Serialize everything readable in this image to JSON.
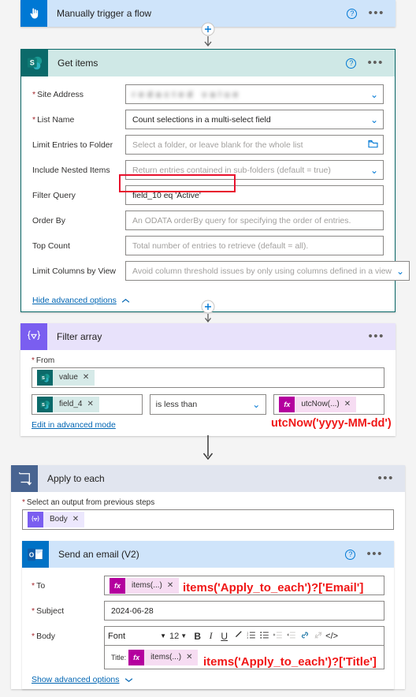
{
  "colors": {
    "canvas": "#f4f4f4",
    "trigger_header": "#cfe4fa",
    "trigger_icon": "#0078d4",
    "sharepoint_teal": "#0b6a6a",
    "getitems_header": "#cfe8e6",
    "filterarray_purple": "#7a5ef0",
    "filterarray_header": "#e8e2fb",
    "applytoeach_icon": "#486491",
    "applytoeach_header": "#e1e5ef",
    "outlook_blue": "#0072c6",
    "annotation_red": "#f01717",
    "link_blue": "#0065b3"
  },
  "trigger": {
    "title": "Manually trigger a flow",
    "icon": "hand-pointer-icon",
    "help_icon": "help-icon",
    "menu_icon": "ellipsis-icon"
  },
  "connectors": {
    "add_icon": "plus-circle-icon",
    "arrow_icon": "arrow-down-icon"
  },
  "get_items": {
    "title": "Get items",
    "icon": "sharepoint-icon",
    "icon_letter": "S",
    "help_icon": "help-icon",
    "menu_icon": "ellipsis-icon",
    "advanced_link": "Hide advanced options",
    "advanced_chevron": "chevron-up-icon",
    "fields": [
      {
        "label": "Site Address",
        "required": true,
        "value": "",
        "placeholder": "",
        "blurred": true,
        "control": "dropdown"
      },
      {
        "label": "List Name",
        "required": true,
        "value": "Count selections in a multi-select field",
        "placeholder": "",
        "control": "dropdown"
      },
      {
        "label": "Limit Entries to Folder",
        "required": false,
        "value": "",
        "placeholder": "Select a folder, or leave blank for the whole list",
        "control": "folder"
      },
      {
        "label": "Include Nested Items",
        "required": false,
        "value": "",
        "placeholder": "Return entries contained in sub-folders (default = true)",
        "control": "dropdown"
      },
      {
        "label": "Filter Query",
        "required": false,
        "value": "field_10 eq 'Active'",
        "placeholder": "",
        "control": "text",
        "highlighted": true
      },
      {
        "label": "Order By",
        "required": false,
        "value": "",
        "placeholder": "An ODATA orderBy query for specifying the order of entries.",
        "control": "text"
      },
      {
        "label": "Top Count",
        "required": false,
        "value": "",
        "placeholder": "Total number of entries to retrieve (default = all).",
        "control": "text"
      },
      {
        "label": "Limit Columns by View",
        "required": false,
        "value": "",
        "placeholder": "Avoid column threshold issues by only using columns defined in a view",
        "control": "dropdown"
      }
    ]
  },
  "filter_array": {
    "title": "Filter array",
    "icon": "expression-braces-icon",
    "icon_glyph": "{▽}",
    "menu_icon": "ellipsis-icon",
    "from_label": "From",
    "from_token": {
      "label": "value",
      "icon": "sharepoint-icon",
      "icon_letter": "S",
      "remove_icon": "remove-token-icon"
    },
    "left_token": {
      "label": "field_4",
      "icon": "sharepoint-icon",
      "icon_letter": "S",
      "remove_icon": "remove-token-icon"
    },
    "operator": "is less than",
    "operator_chevron": "chevron-down-icon",
    "right_token": {
      "label": "utcNow(...)",
      "icon": "function-icon",
      "icon_letter": "fx",
      "remove_icon": "remove-token-icon"
    },
    "advanced_link": "Edit in advanced mode",
    "annotation": "utcNow('yyyy-MM-dd')"
  },
  "apply_to_each": {
    "title": "Apply to each",
    "icon": "loop-icon",
    "menu_icon": "ellipsis-icon",
    "select_label": "Select an output from previous steps",
    "body_token": {
      "label": "Body",
      "icon": "expression-braces-icon",
      "icon_glyph": "{▽}",
      "remove_icon": "remove-token-icon"
    }
  },
  "send_email": {
    "title": "Send an email (V2)",
    "icon": "outlook-icon",
    "icon_letter": "O",
    "help_icon": "help-icon",
    "menu_icon": "ellipsis-icon",
    "to_label": "To",
    "to_token": {
      "label": "items(...)",
      "icon": "function-icon",
      "icon_letter": "fx",
      "remove_icon": "remove-token-icon"
    },
    "to_annotation": "items('Apply_to_each')?['Email']",
    "subject_label": "Subject",
    "subject_value": "2024-06-28",
    "body_label": "Body",
    "toolbar": {
      "font_label": "Font",
      "font_chevron": "chevron-down-icon",
      "size_label": "12",
      "size_chevron": "chevron-down-icon",
      "bold": "B",
      "italic": "I",
      "underline": "U",
      "highlight_icon": "pen-highlight-icon",
      "numbered_list_icon": "numbered-list-icon",
      "bullet_list_icon": "bullet-list-icon",
      "indent_icon": "indent-icon",
      "outdent_icon": "outdent-icon",
      "link_icon": "link-icon",
      "unlink_icon": "unlink-icon",
      "code_icon": "code-view-icon"
    },
    "body_prefix": "Title:",
    "body_token": {
      "label": "items(...)",
      "icon": "function-icon",
      "icon_letter": "fx",
      "remove_icon": "remove-token-icon"
    },
    "body_annotation": "items('Apply_to_each')?['Title']",
    "advanced_link": "Show advanced options",
    "advanced_chevron": "chevron-down-icon"
  }
}
